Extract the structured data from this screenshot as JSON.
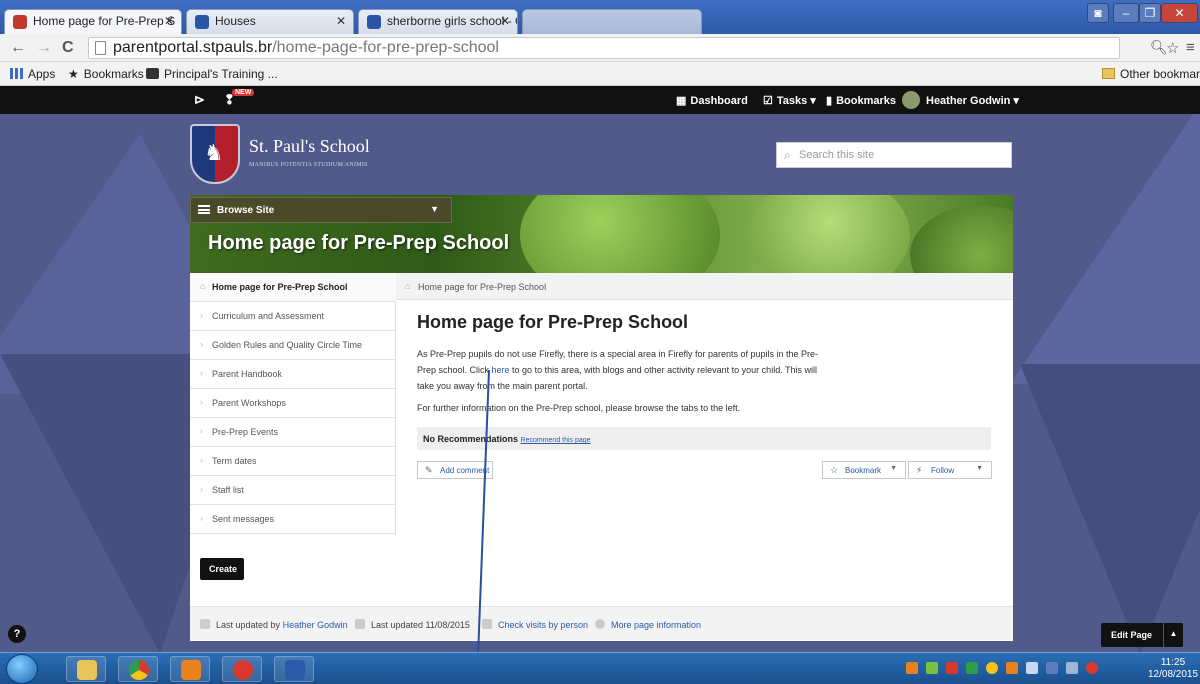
{
  "browser": {
    "tabs": [
      {
        "title": "Home page for Pre-Prep S",
        "color": "#c0392b"
      },
      {
        "title": "Houses",
        "color": "#2a54a6"
      },
      {
        "title": "sherborne girls school - G",
        "color": "#2a54a6"
      }
    ],
    "url_host": "parentportal.stpauls.br",
    "url_path": "/home-page-for-pre-prep-school",
    "bookmarks": [
      "Apps",
      "Bookmarks",
      "Principal's Training ..."
    ],
    "other_bookmarks": "Other bookmarks"
  },
  "firefly_bar": {
    "new_badge": "NEW",
    "dashboard": "Dashboard",
    "tasks": "Tasks",
    "bookmarks": "Bookmarks",
    "user": "Heather Godwin"
  },
  "site": {
    "name": "St. Paul's School",
    "motto": "MANIBUS POTENTIA STUDIUM ANIMIS",
    "search_placeholder": "Search this site",
    "browse_label": "Browse Site",
    "banner_title": "Home page for Pre-Prep School"
  },
  "sidenav": {
    "items": [
      {
        "label": "Home page for Pre-Prep School"
      },
      {
        "label": "Curriculum and Assessment"
      },
      {
        "label": "Golden Rules and Quality Circle Time"
      },
      {
        "label": "Parent Handbook"
      },
      {
        "label": "Parent Workshops"
      },
      {
        "label": "Pre-Prep Events"
      },
      {
        "label": "Term dates"
      },
      {
        "label": "Staff list"
      },
      {
        "label": "Sent messages"
      }
    ]
  },
  "breadcrumb": "Home page for Pre-Prep School",
  "main": {
    "title": "Home page for Pre-Prep School",
    "para_before": "As Pre-Prep pupils do not use Firefly, there is a special area in Firefly for parents of pupils in the Pre-Prep school. Click ",
    "para_link": "here",
    "para_after": " to go to this area, with blogs and other activity relevant to your child. This will take you away from the main parent portal.",
    "para2": "For further information on the Pre-Prep school, please browse the tabs to the left.",
    "no_recs": "No Recommendations",
    "recommend_link": "Recommend this page",
    "add_comment": "Add comment",
    "bookmark": "Bookmark",
    "follow": "Follow"
  },
  "create_label": "Create",
  "footer": {
    "updated_by_prefix": "Last updated by",
    "updated_by_name": "Heather Godwin",
    "updated_date": "Last updated 11/08/2015",
    "check_visits": "Check visits by person",
    "more_info": "More page information"
  },
  "help_label": "?",
  "edit_page": "Edit Page",
  "taskbar": {
    "time": "11:25",
    "date": "12/08/2015"
  }
}
